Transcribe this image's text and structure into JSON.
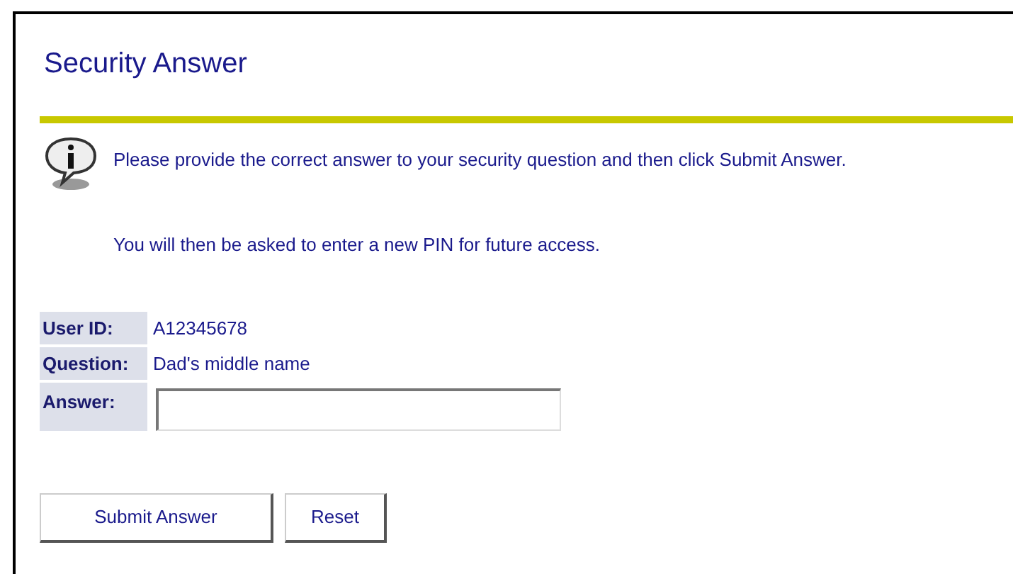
{
  "title": "Security Answer",
  "info": [
    "Please provide the correct answer to your security question and then click Submit Answer.",
    "You will then be asked to enter a new PIN for future access."
  ],
  "fields": [
    {
      "label": "User ID:",
      "value": "A12345678",
      "kind": "text"
    },
    {
      "label": "Question:",
      "value": "Dad's middle name",
      "kind": "text"
    },
    {
      "label": "Answer:",
      "kind": "input"
    }
  ],
  "buttons": [
    "Submit Answer",
    "Reset"
  ]
}
